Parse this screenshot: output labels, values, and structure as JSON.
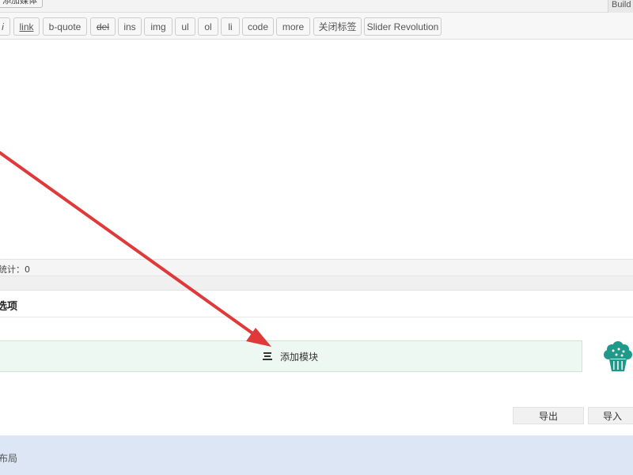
{
  "top": {
    "button_label": "添加媒体",
    "build_tab": "Build"
  },
  "toolbar": {
    "buttons": [
      {
        "label": "i"
      },
      {
        "label": "link"
      },
      {
        "label": "b-quote"
      },
      {
        "label": "del"
      },
      {
        "label": "ins"
      },
      {
        "label": "img"
      },
      {
        "label": "ul"
      },
      {
        "label": "ol"
      },
      {
        "label": "li"
      },
      {
        "label": "code"
      },
      {
        "label": "more"
      },
      {
        "label": "关闭标签"
      },
      {
        "label": "Slider Revolution"
      }
    ]
  },
  "editor": {
    "status_text": "统计：0"
  },
  "options": {
    "title": "选项"
  },
  "builder": {
    "add_module_label": "添加模块",
    "add_module_icon": "hamburger-icon",
    "mascot_icon": "cupcake-icon",
    "mascot_color": "#1f9a8a",
    "export_label": "导出",
    "import_label": "导入"
  },
  "footer": {
    "text": "布局"
  },
  "annotation": {
    "arrow_color": "#e0393a"
  }
}
